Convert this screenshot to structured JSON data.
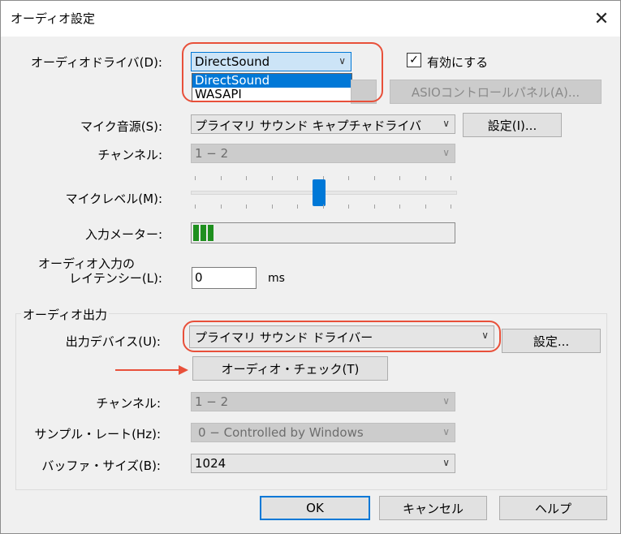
{
  "window": {
    "title": "オーディオ設定"
  },
  "driver": {
    "label": "オーディオドライバ(D):",
    "selected": "DirectSound",
    "options": [
      "DirectSound",
      "WASAPI"
    ],
    "enable_label": "有効にする",
    "enable_checked": true,
    "asio_button": "ASIOコントロールパネル(A)..."
  },
  "mic_source": {
    "label": "マイク音源(S):",
    "value": "プライマリ サウンド キャプチャドライバ",
    "settings_button": "設定(I)..."
  },
  "input_channel": {
    "label": "チャンネル:",
    "value": "1 − 2"
  },
  "mic_level": {
    "label": "マイクレベル(M):",
    "level": 0.48
  },
  "input_meter": {
    "label": "入力メーター:",
    "bars": 3
  },
  "latency": {
    "label_line1": "オーディオ入力の",
    "label_line2": "レイテンシー(L):",
    "value": "0",
    "unit": "ms"
  },
  "output": {
    "group_title": "オーディオ出力",
    "device_label": "出力デバイス(U):",
    "device_value": "プライマリ サウンド ドライバー",
    "settings_button": "設定...",
    "check_button": "オーディオ・チェック(T)",
    "channel_label": "チャンネル:",
    "channel_value": "1 − 2",
    "rate_label": "サンプル・レート(Hz):",
    "rate_value": "0 − Controlled by Windows",
    "buffer_label": "バッファ・サイズ(B):",
    "buffer_value": "1024"
  },
  "footer": {
    "ok": "OK",
    "cancel": "キャンセル",
    "help": "ヘルプ"
  },
  "colors": {
    "accent": "#0078d7",
    "annotation": "#e8503a",
    "meter": "#1e8f1e"
  }
}
